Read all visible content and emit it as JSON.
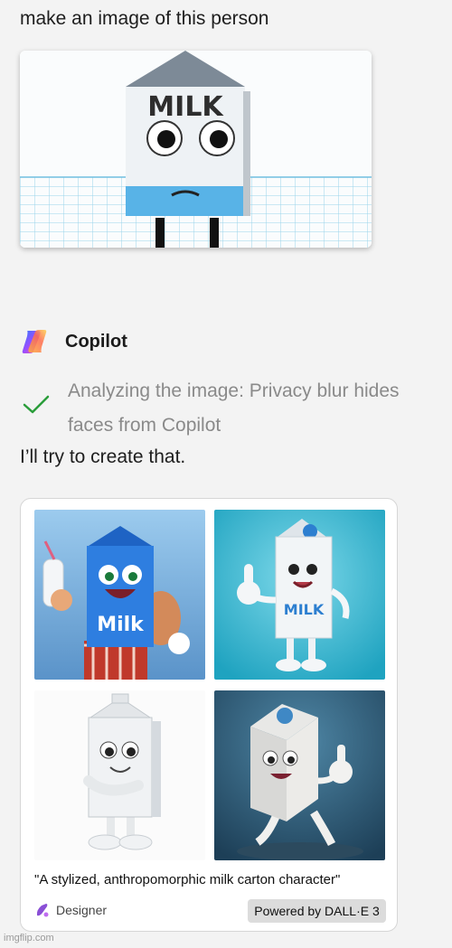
{
  "user_message": {
    "prompt": "make an image of this person"
  },
  "assistant": {
    "name": "Copilot",
    "status": "Analyzing the image: Privacy blur hides faces from Copilot",
    "reply": "I’ll try to create that."
  },
  "uploaded_image": {
    "label": "MILK"
  },
  "result_card": {
    "images": [
      {
        "label": "Milk"
      },
      {
        "label": "MILK"
      },
      {
        "label": ""
      },
      {
        "label": ""
      }
    ],
    "caption": "\"A stylized, anthropomorphic milk carton character\"",
    "designer_label": "Designer",
    "powered_by": "Powered by DALL·E 3"
  },
  "watermark": "imgflip.com",
  "colors": {
    "check": "#2a9d3a",
    "designer_icon": "#8a4fd6",
    "tile1_bg": "#7fb7e0",
    "tile2_bg": "#30b4cc"
  }
}
